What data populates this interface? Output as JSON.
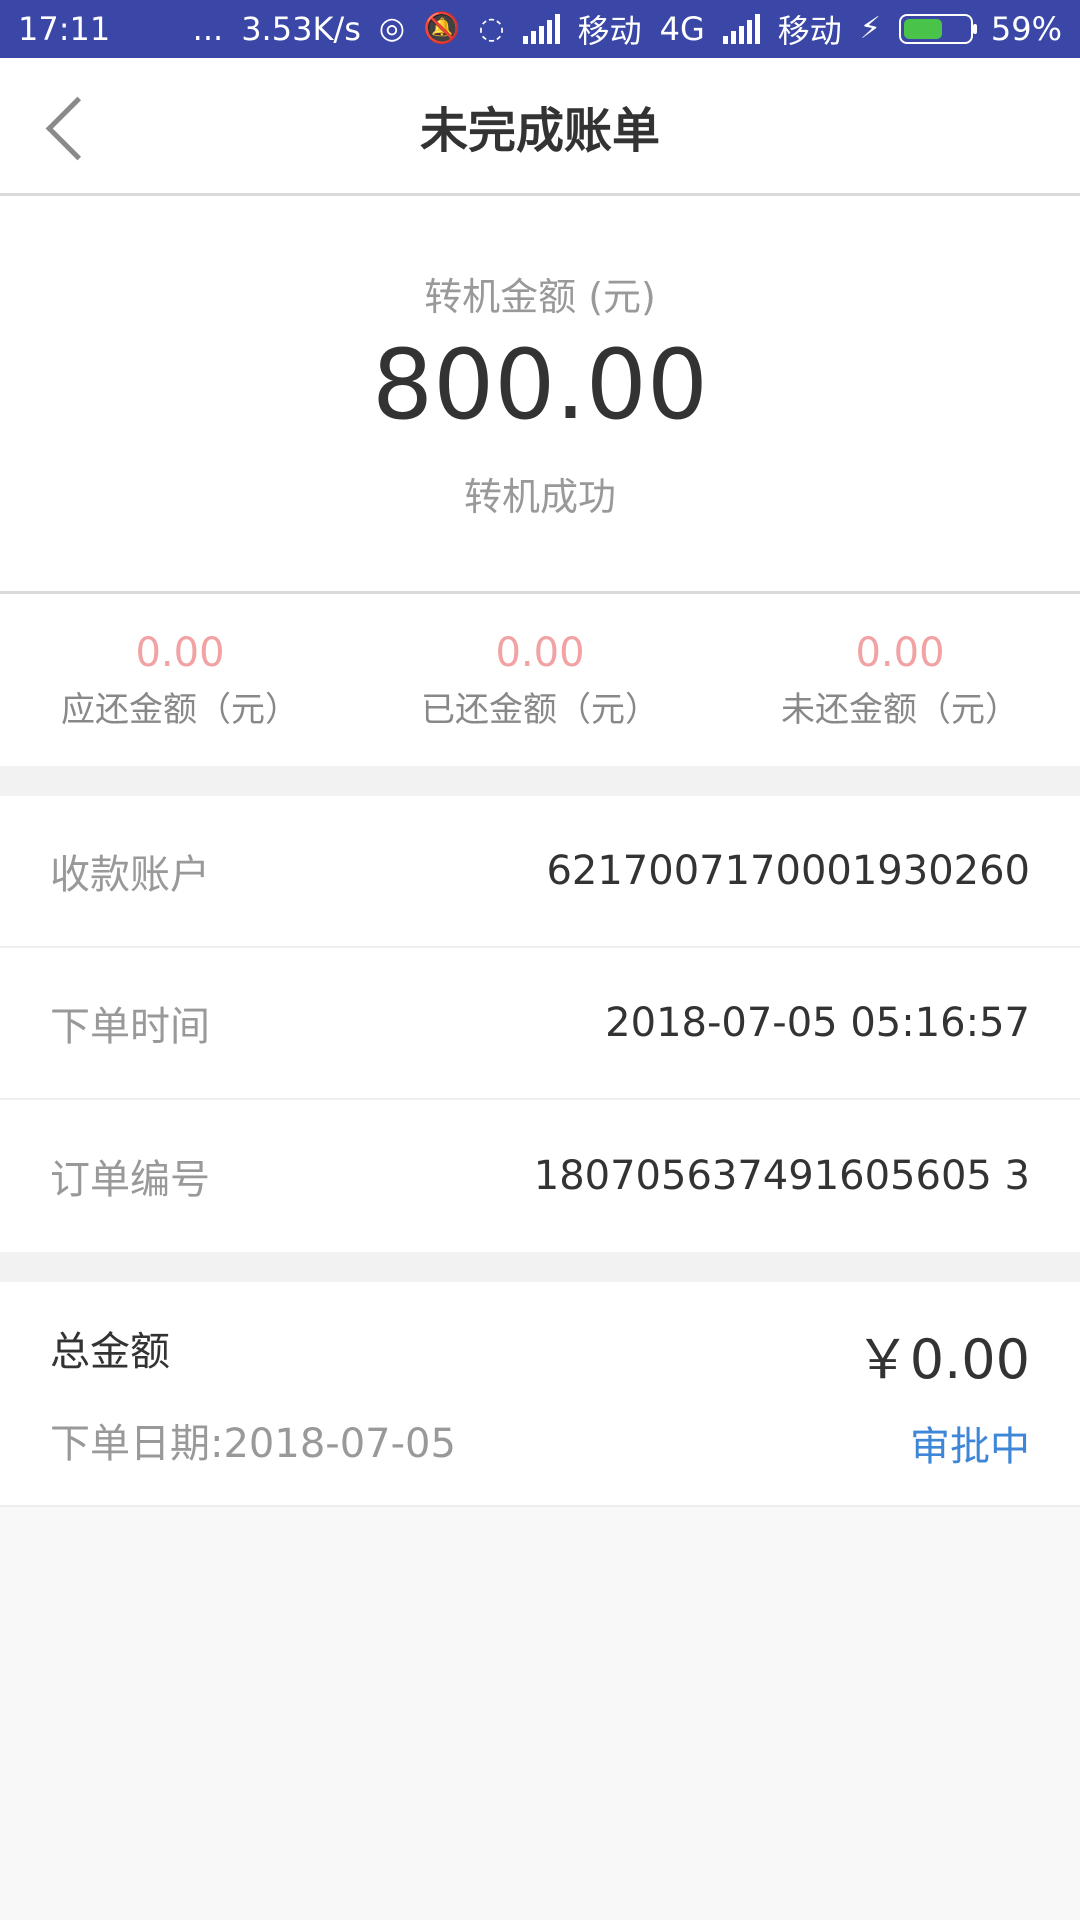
{
  "status_bar": {
    "time": "17:11",
    "dots": "...",
    "speed": "3.53K/s",
    "carrier1": "移动",
    "network1": "4G",
    "carrier2": "移动",
    "battery": "59%",
    "battery_level": 0.59
  },
  "header": {
    "title": "未完成账单"
  },
  "summary": {
    "label": "转机金额 (元)",
    "amount": "800.00",
    "status": "转机成功"
  },
  "stats": [
    {
      "value": "0.00",
      "label": "应还金额（元）"
    },
    {
      "value": "0.00",
      "label": "已还金额（元）"
    },
    {
      "value": "0.00",
      "label": "未还金额（元）"
    }
  ],
  "info_rows": [
    {
      "label": "收款账户",
      "value": "6217007170001930260"
    },
    {
      "label": "下单时间",
      "value": "2018-07-05 05:16:57"
    },
    {
      "label": "订单编号",
      "value": "180705637491605605 3"
    }
  ],
  "total": {
    "label": "总金额",
    "amount": "￥0.00",
    "date_text": "下单日期:2018-07-05",
    "status": "审批中"
  },
  "colors": {
    "status_bar": "#3a47a7",
    "stat_value": "#f2a2a2",
    "approval": "#3d86d8"
  }
}
